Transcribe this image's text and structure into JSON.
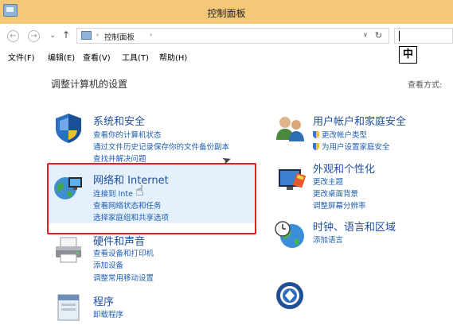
{
  "window": {
    "title": "控制面板"
  },
  "address_bar": {
    "back_icon": "left-arrow",
    "forward_icon": "right-arrow",
    "recent_icon": "chevron-down",
    "up_icon": "up-arrow",
    "breadcrumb": [
      "控制面板"
    ],
    "dropdown_glyph": "∨",
    "refresh_glyph": "↻"
  },
  "ime": {
    "label": "中"
  },
  "menu": {
    "items": [
      "文件(F)",
      "编辑(E)",
      "查看(V)",
      "工具(T)",
      "帮助(H)"
    ]
  },
  "content": {
    "title": "调整计算机的设置",
    "view_by": "查看方式:",
    "categories": [
      {
        "title": "系统和安全",
        "icon": "shield-security-icon",
        "links": [
          "查看你的计算机状态",
          "通过文件历史记录保存你的文件备份副本",
          "查找并解决问题"
        ]
      },
      {
        "title": "网络和 Internet",
        "icon": "network-globe-icon",
        "links": [
          "连接到 Inte",
          "查看网络状态和任务",
          "选择家庭组和共享选项"
        ]
      },
      {
        "title": "硬件和声音",
        "icon": "printer-icon",
        "links": [
          "查看设备和打印机",
          "添加设备",
          "调整常用移动设置"
        ]
      },
      {
        "title": "程序",
        "icon": "programs-icon",
        "links": [
          "卸载程序"
        ]
      },
      {
        "title": "用户帐户和家庭安全",
        "icon": "users-icon",
        "links": [
          "更改帐户类型",
          "为用户设置家庭安全"
        ]
      },
      {
        "title": "外观和个性化",
        "icon": "appearance-icon",
        "links": [
          "更改主题",
          "更改桌面背景",
          "调整屏幕分辨率"
        ]
      },
      {
        "title": "时钟、语言和区域",
        "icon": "clock-globe-icon",
        "links": [
          "添加语言"
        ]
      },
      {
        "title": "",
        "icon": "ease-of-access-icon",
        "links": []
      }
    ]
  },
  "colors": {
    "titlebar": "#f4c878",
    "link": "#1f5fb0",
    "category_title": "#1f4e9e",
    "highlight_border": "#e02020"
  }
}
